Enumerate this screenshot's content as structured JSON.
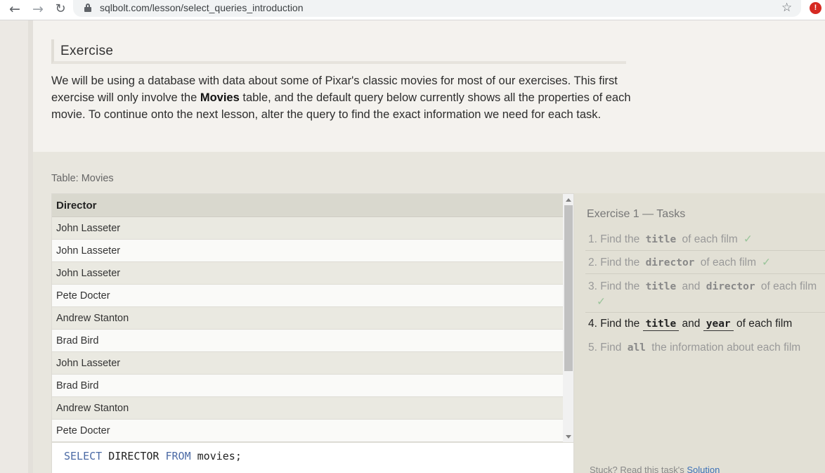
{
  "browser": {
    "back_icon": "←",
    "forward_icon": "→",
    "reload_icon": "↻",
    "url": "sqlbolt.com/lesson/select_queries_introduction",
    "star_icon": "☆",
    "extension_icon": "!"
  },
  "exercise": {
    "heading": "Exercise",
    "intro_1": "We will be using a database with data about some of Pixar's classic movies for most of our exercises. This first exercise will only involve the ",
    "intro_bold": "Movies",
    "intro_2": " table, and the default query below currently shows all the properties of each movie. To continue onto the next lesson, alter the query to find the exact information we need for each task."
  },
  "table": {
    "caption": "Table: Movies",
    "columns": [
      "Director"
    ],
    "rows": [
      "John Lasseter",
      "John Lasseter",
      "John Lasseter",
      "Pete Docter",
      "Andrew Stanton",
      "Brad Bird",
      "John Lasseter",
      "Brad Bird",
      "Andrew Stanton",
      "Pete Docter"
    ]
  },
  "editor": {
    "kw_select": "SELECT",
    "col": " DIRECTOR ",
    "kw_from": "FROM",
    "rest": " movies;"
  },
  "tasks": {
    "title": "Exercise 1 — Tasks",
    "items": [
      {
        "num": "1.",
        "pre": "Find the",
        "code1": "title",
        "mid": "",
        "code2": "",
        "post": "of each film",
        "check": "✓"
      },
      {
        "num": "2.",
        "pre": "Find the",
        "code1": "director",
        "mid": "",
        "code2": "",
        "post": "of each film",
        "check": "✓"
      },
      {
        "num": "3.",
        "pre": "Find the",
        "code1": "title",
        "mid": "and",
        "code2": "director",
        "post": "of each film",
        "check": "✓"
      },
      {
        "num": "4.",
        "pre": "Find the",
        "code1": "title",
        "mid": "and",
        "code2": "year",
        "post": "of each film",
        "check": ""
      },
      {
        "num": "5.",
        "pre": "Find",
        "code1": "all",
        "mid": "",
        "code2": "",
        "post": "the information about each film",
        "check": ""
      }
    ],
    "stuck_text": "Stuck? Read this task's ",
    "solution_link": "Solution"
  }
}
